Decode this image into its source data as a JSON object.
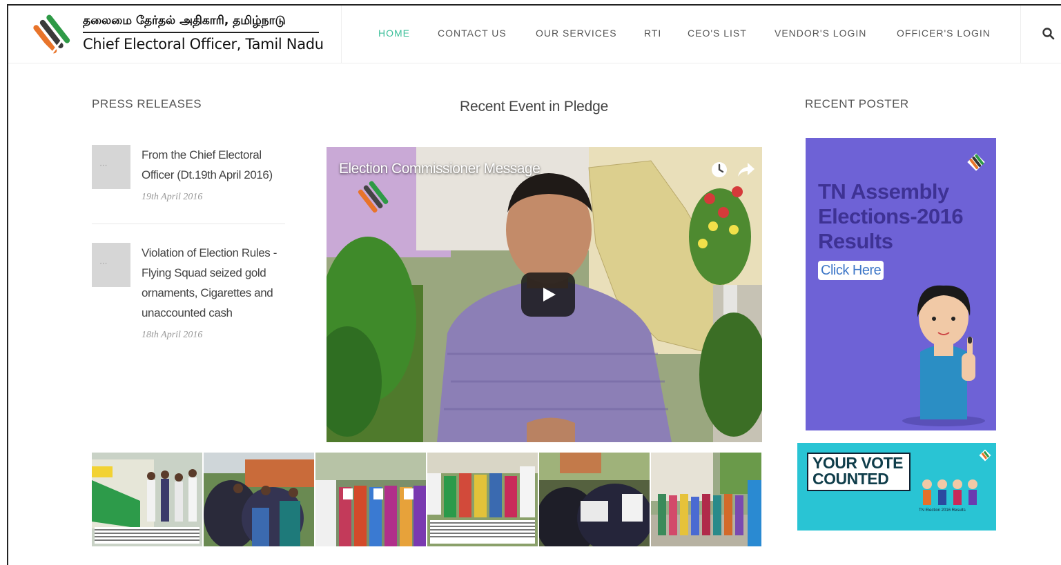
{
  "header": {
    "site_title_tamil": "தலைமை தேர்தல் அதிகாரி, தமிழ்நாடு",
    "site_title_english": "Chief Electoral Officer, Tamil Nadu",
    "logo_icon": "ballot-ink-finger-logo",
    "nav": [
      {
        "label": "HOME",
        "active": true
      },
      {
        "label": "CONTACT US",
        "active": false
      },
      {
        "label": "OUR SERVICES",
        "active": false
      },
      {
        "label": "RTI",
        "active": false
      },
      {
        "label": "CEO'S LIST",
        "active": false
      },
      {
        "label": "VENDOR'S LOGIN",
        "active": false
      },
      {
        "label": "OFFICER'S LOGIN",
        "active": false
      }
    ],
    "search_icon": "search-icon",
    "accent_color": "#3cbf9a"
  },
  "press_releases": {
    "heading": "PRESS RELEASES",
    "items": [
      {
        "title": "From the Chief Electoral Officer (Dt.19th April 2016)",
        "date": "19th April 2016"
      },
      {
        "title": "Violation of Election Rules - Flying Squad seized gold ornaments, Cigarettes and unaccounted cash",
        "date": "18th April 2016"
      }
    ]
  },
  "event": {
    "heading": "Recent Event in Pledge",
    "video_title": "Election Commissioner Message",
    "play_icon": "play-icon",
    "clock_icon": "watch-later-icon",
    "share_icon": "share-icon"
  },
  "gallery": {
    "count": 6
  },
  "posters": {
    "heading": "RECENT POSTER",
    "poster1_title": "TN Assembly Elections-2016 Results",
    "poster1_button": "Click Here",
    "poster1_color": "#6e62d6",
    "poster2_title": "YOUR VOTE COUNTED",
    "poster2_small": "TN Election 2016 Results",
    "poster2_color": "#29c4d4"
  }
}
